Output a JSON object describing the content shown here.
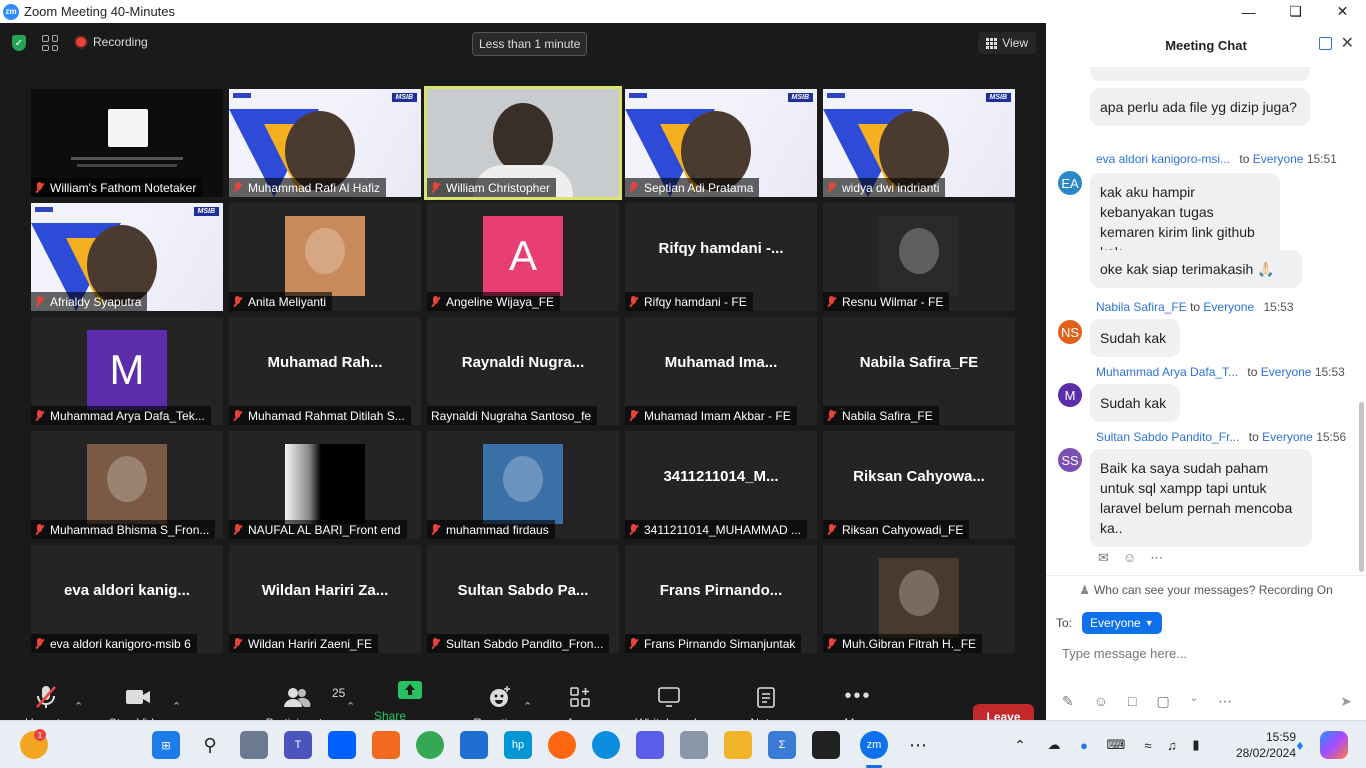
{
  "window": {
    "title": "Zoom Meeting 40-Minutes",
    "logo": "zm"
  },
  "topbar": {
    "recording": "Recording",
    "timer": "Less than 1 minute",
    "view": "View"
  },
  "tiles": [
    {
      "name": "William's Fathom Notetaker",
      "kind": "screen"
    },
    {
      "name": "Muhammad Rafi Al Hafiz",
      "kind": "msib"
    },
    {
      "name": "William Christopher",
      "kind": "video",
      "active": true
    },
    {
      "name": "Septian Adi Pratama",
      "kind": "msib"
    },
    {
      "name": "widya dwi indrianti",
      "kind": "msib"
    },
    {
      "name": "Afrialdy Syaputra",
      "kind": "msib"
    },
    {
      "name": "Anita Meliyanti",
      "kind": "photo",
      "color": "#c88a5a"
    },
    {
      "name": "Angeline Wijaya_FE",
      "kind": "letter",
      "letter": "A",
      "color": "#e83e73"
    },
    {
      "name": "Rifqy hamdani - FE",
      "kind": "text",
      "big": "Rifqy  hamdani  -..."
    },
    {
      "name": "Resnu Wilmar - FE",
      "kind": "photo",
      "color": "#2a2a2a"
    },
    {
      "name": "Muhammad Arya Dafa_Tek...",
      "kind": "letter",
      "letter": "M",
      "color": "#5b2dab"
    },
    {
      "name": "Muhamad Rahmat Ditilah S...",
      "kind": "text",
      "big": "Muhamad  Rah..."
    },
    {
      "name": "Raynaldi Nugraha Santoso_fe",
      "kind": "text",
      "big": "Raynaldi  Nugra...",
      "nomic": true
    },
    {
      "name": "Muhamad Imam Akbar - FE",
      "kind": "text",
      "big": "Muhamad  Ima..."
    },
    {
      "name": "Nabila Safira_FE",
      "kind": "text",
      "big": "Nabila Safira_FE"
    },
    {
      "name": "Muhammad Bhisma S_Fron...",
      "kind": "photo",
      "color": "#7a5a44"
    },
    {
      "name": "NAUFAL AL BARI_Front end",
      "kind": "gradient"
    },
    {
      "name": "muhammad firdaus",
      "kind": "photo",
      "color": "#3b6fa8"
    },
    {
      "name": "3411211014_MUHAMMAD ...",
      "kind": "text",
      "big": "3411211014_M..."
    },
    {
      "name": "Riksan Cahyowadi_FE",
      "kind": "text",
      "big": "Riksan  Cahyowa..."
    },
    {
      "name": "eva aldori kanigoro-msib 6",
      "kind": "text",
      "big": "eva  aldori  kanig..."
    },
    {
      "name": "Wildan Hariri Zaeni_FE",
      "kind": "text",
      "big": "Wildan  Hariri  Za..."
    },
    {
      "name": "Sultan Sabdo Pandito_Fron...",
      "kind": "text",
      "big": "Sultan  Sabdo  Pa..."
    },
    {
      "name": "Frans Pirnando Simanjuntak",
      "kind": "text",
      "big": "Frans  Pirnando..."
    },
    {
      "name": "Muh.Gibran Fitrah H._FE",
      "kind": "photo",
      "color": "#4a3a2e"
    }
  ],
  "toolbar": {
    "unmute": "Unmute",
    "stop_video": "Stop Video",
    "participants": "Participants",
    "participants_count": "25",
    "share": "Share Screen",
    "reactions": "Reactions",
    "apps": "Apps",
    "whiteboards": "Whiteboards",
    "notes": "Notes",
    "more": "More",
    "leave": "Leave"
  },
  "chat": {
    "title": "Meeting Chat",
    "messages": [
      {
        "text": "apa perlu ada file yg dizip juga?"
      },
      {
        "sender": "eva aldori kanigoro-msi...",
        "to": "to",
        "target": "Everyone",
        "time": "15:51",
        "initials": "EA",
        "color": "#2a88c9",
        "text": "kak aku hampir kebanyakan tugas kemaren kirim link github kak"
      },
      {
        "text": "oke kak siap terimakasih 🙏🏻"
      },
      {
        "sender": "Nabila Safira_FE",
        "to": "to",
        "target": "Everyone",
        "time": "15:53",
        "initials": "NS",
        "color": "#e0611c",
        "text": "Sudah kak"
      },
      {
        "sender": "Muhammad Arya Dafa_T...",
        "to": "to",
        "target": "Everyone",
        "time": "15:53",
        "initials": "M",
        "color": "#5b2dab",
        "text": "Sudah kak"
      },
      {
        "sender": "Sultan Sabdo Pandito_Fr...",
        "to": "to",
        "target": "Everyone",
        "time": "15:56",
        "initials": "SS",
        "color": "#7b4fb3",
        "text": "Baik ka saya sudah paham untuk sql xampp tapi untuk laravel belum pernah mencoba ka.."
      }
    ],
    "who_can_see": "Who can see your messages? Recording On",
    "to_label": "To:",
    "recipient": "Everyone",
    "placeholder": "Type message here..."
  },
  "taskbar": {
    "time": "15:59",
    "date": "28/02/2024",
    "notif_count": "1"
  }
}
